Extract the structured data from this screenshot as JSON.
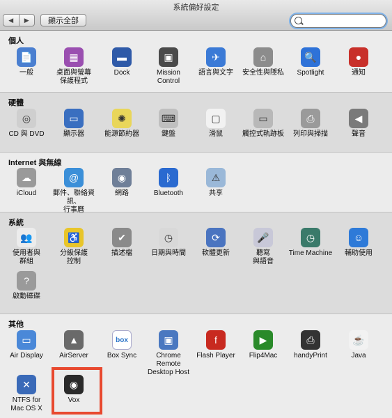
{
  "window": {
    "title": "系統偏好設定"
  },
  "toolbar": {
    "back": "◀",
    "forward": "▶",
    "show_all": "顯示全部",
    "search_placeholder": ""
  },
  "sections": [
    {
      "title": "個人",
      "items": [
        {
          "label": "一般",
          "icon": "general-icon",
          "color": "#4a7fd0",
          "glyph": "📄"
        },
        {
          "label": "桌面與螢幕\n保護程式",
          "icon": "desktop-screensaver-icon",
          "color": "#9a4fb0",
          "glyph": "▦"
        },
        {
          "label": "Dock",
          "icon": "dock-icon",
          "color": "#2f5aa8",
          "glyph": "▬"
        },
        {
          "label": "Mission\nControl",
          "icon": "mission-control-icon",
          "color": "#4a4a4a",
          "glyph": "▣"
        },
        {
          "label": "語言與文字",
          "icon": "language-text-icon",
          "color": "#3b7ad6",
          "glyph": "✈"
        },
        {
          "label": "安全性與隱私",
          "icon": "security-privacy-icon",
          "color": "#8c8c8c",
          "glyph": "⌂"
        },
        {
          "label": "Spotlight",
          "icon": "spotlight-icon",
          "color": "#2e72d8",
          "glyph": "🔍"
        },
        {
          "label": "通知",
          "icon": "notifications-icon",
          "color": "#c8302a",
          "glyph": "●"
        }
      ]
    },
    {
      "title": "硬體",
      "items": [
        {
          "label": "CD 與 DVD",
          "icon": "cd-dvd-icon",
          "color": "#cfcfcf",
          "glyph": "◎"
        },
        {
          "label": "顯示器",
          "icon": "displays-icon",
          "color": "#3a6fc0",
          "glyph": "▭"
        },
        {
          "label": "能源節約器",
          "icon": "energy-saver-icon",
          "color": "#e9d65a",
          "glyph": "✺"
        },
        {
          "label": "鍵盤",
          "icon": "keyboard-icon",
          "color": "#bfbfbf",
          "glyph": "⌨"
        },
        {
          "label": "滑鼠",
          "icon": "mouse-icon",
          "color": "#f2f2f2",
          "glyph": "▢"
        },
        {
          "label": "觸控式軌跡板",
          "icon": "trackpad-icon",
          "color": "#b8b8b8",
          "glyph": "▭"
        },
        {
          "label": "列印與掃描",
          "icon": "print-scan-icon",
          "color": "#9a9a9a",
          "glyph": "⎙"
        },
        {
          "label": "聲音",
          "icon": "sound-icon",
          "color": "#7a7a7a",
          "glyph": "◀"
        }
      ]
    },
    {
      "title": "Internet 與無線",
      "items": [
        {
          "label": "iCloud",
          "icon": "icloud-icon",
          "color": "#9a9a9a",
          "glyph": "☁"
        },
        {
          "label": "郵件、聯絡資訊、\n行事曆",
          "icon": "mail-contacts-calendar-icon",
          "color": "#3b8fd8",
          "glyph": "@"
        },
        {
          "label": "網路",
          "icon": "network-icon",
          "color": "#6f7f98",
          "glyph": "◉"
        },
        {
          "label": "Bluetooth",
          "icon": "bluetooth-icon",
          "color": "#2a6ad0",
          "glyph": "ᛒ"
        },
        {
          "label": "共享",
          "icon": "sharing-icon",
          "color": "#9ab8d8",
          "glyph": "⚠"
        }
      ]
    },
    {
      "title": "系統",
      "items": [
        {
          "label": "使用者與\n群組",
          "icon": "users-groups-icon",
          "color": "#ececec",
          "glyph": "👥"
        },
        {
          "label": "分級保護\n控制",
          "icon": "parental-controls-icon",
          "color": "#e8c52a",
          "glyph": "♿"
        },
        {
          "label": "描述檔",
          "icon": "profiles-icon",
          "color": "#8a8a8a",
          "glyph": "✔"
        },
        {
          "label": "日期與時間",
          "icon": "date-time-icon",
          "color": "#d8d8d8",
          "glyph": "◷"
        },
        {
          "label": "軟體更新",
          "icon": "software-update-icon",
          "color": "#4a74c0",
          "glyph": "⟳"
        },
        {
          "label": "聽寫\n與語音",
          "icon": "dictation-speech-icon",
          "color": "#c8c8d8",
          "glyph": "🎤"
        },
        {
          "label": "Time Machine",
          "icon": "time-machine-icon",
          "color": "#3a7a6a",
          "glyph": "◷"
        },
        {
          "label": "輔助使用",
          "icon": "accessibility-icon",
          "color": "#2e7ad8",
          "glyph": "☺"
        },
        {
          "label": "啟動磁碟",
          "icon": "startup-disk-icon",
          "color": "#9a9a9a",
          "glyph": "?"
        }
      ]
    },
    {
      "title": "其他",
      "items": [
        {
          "label": "Air Display",
          "icon": "air-display-icon",
          "color": "#4a88d8",
          "glyph": "▭"
        },
        {
          "label": "AirServer",
          "icon": "airserver-icon",
          "color": "#6a6a6a",
          "glyph": "▲"
        },
        {
          "label": "Box Sync",
          "icon": "box-sync-icon",
          "color": "#2a74c8",
          "glyph": "box"
        },
        {
          "label": "Chrome Remote\nDesktop Host",
          "icon": "chrome-remote-desktop-icon",
          "color": "#4a78c0",
          "glyph": "▣"
        },
        {
          "label": "Flash Player",
          "icon": "flash-player-icon",
          "color": "#c82a20",
          "glyph": "f"
        },
        {
          "label": "Flip4Mac",
          "icon": "flip4mac-icon",
          "color": "#2a8a2a",
          "glyph": "▶"
        },
        {
          "label": "handyPrint",
          "icon": "handyprint-icon",
          "color": "#333333",
          "glyph": "⎙"
        },
        {
          "label": "Java",
          "icon": "java-icon",
          "color": "#f2f2f2",
          "glyph": "☕"
        },
        {
          "label": "NTFS for\nMac OS X",
          "icon": "ntfs-icon",
          "color": "#3a6ab8",
          "glyph": "✕"
        },
        {
          "label": "Vox",
          "icon": "vox-icon",
          "color": "#2a2a2a",
          "glyph": "◉"
        }
      ]
    }
  ]
}
